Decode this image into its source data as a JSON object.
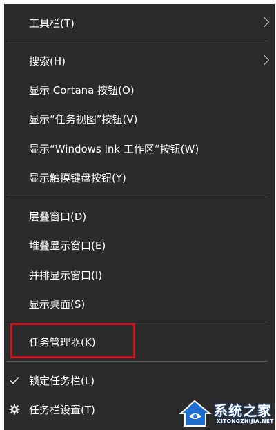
{
  "menu": {
    "items": [
      {
        "label": "工具栏(T)",
        "submenu": true
      },
      {
        "label": "搜索(H)",
        "submenu": true
      },
      {
        "label": "显示 Cortana 按钮(O)"
      },
      {
        "label": "显示“任务视图”按钮(V)"
      },
      {
        "label": "显示“Windows Ink 工作区”按钮(W)"
      },
      {
        "label": "显示触摸键盘按钮(Y)"
      },
      {
        "label": "层叠窗口(D)"
      },
      {
        "label": "堆叠显示窗口(E)"
      },
      {
        "label": "并排显示窗口(I)"
      },
      {
        "label": "显示桌面(S)"
      },
      {
        "label": "任务管理器(K)",
        "highlighted": true
      },
      {
        "label": "锁定任务栏(L)",
        "checked": true,
        "icon": "checkmark-icon"
      },
      {
        "label": "任务栏设置(T)",
        "icon": "gear-icon"
      }
    ]
  },
  "watermark": {
    "title": "系统之家",
    "subtitle": "XITONGZHIJIA.NET"
  },
  "colors": {
    "menu_bg": "#2b2b2b",
    "text": "#ffffff",
    "separator": "#5a5a5a",
    "highlight_border": "#c8141e"
  }
}
